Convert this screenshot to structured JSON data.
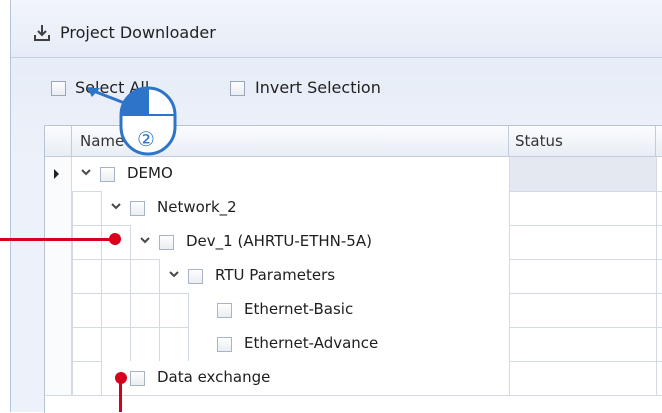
{
  "window": {
    "title": "Project Downloader",
    "icon": "download-icon"
  },
  "toolbar": {
    "select_all_label": "Select All",
    "invert_selection_label": "Invert Selection"
  },
  "grid": {
    "columns": [
      "Name",
      "Status"
    ],
    "rows": [
      {
        "label": "DEMO",
        "level": 0,
        "expanded": true,
        "has_children": true,
        "current": true
      },
      {
        "label": "Network_2",
        "level": 1,
        "expanded": true,
        "has_children": true
      },
      {
        "label": "Dev_1 (AHRTU-ETHN-5A)",
        "level": 2,
        "expanded": true,
        "has_children": true
      },
      {
        "label": "RTU Parameters",
        "level": 3,
        "expanded": true,
        "has_children": true
      },
      {
        "label": "Ethernet-Basic",
        "level": 4,
        "has_children": false
      },
      {
        "label": "Ethernet-Advance",
        "level": 4,
        "has_children": false
      },
      {
        "label": "Data exchange",
        "level": 1,
        "has_children": false
      }
    ]
  },
  "annotation": {
    "step_number": "②",
    "marker_color": "#d6001c",
    "mouse_color": "#2e74c9"
  }
}
